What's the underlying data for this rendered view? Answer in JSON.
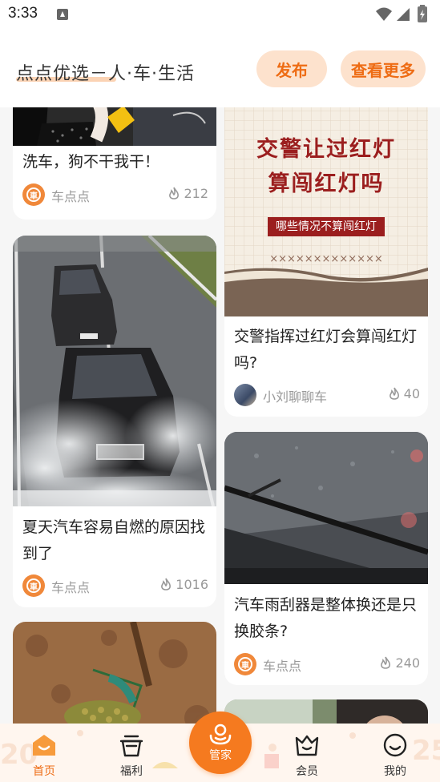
{
  "status_bar": {
    "time": "3:33"
  },
  "header": {
    "brand": "点点优选－人·车·生活",
    "publish_label": "发布",
    "more_label": "查看更多"
  },
  "feed": {
    "left": [
      {
        "title": "洗车，狗不干我干！",
        "author": "车点点",
        "likes": "212"
      },
      {
        "title": "夏天汽车容易自燃的原因找到了",
        "author": "车点点",
        "likes": "1016"
      },
      {
        "title": "",
        "author": "",
        "likes": ""
      }
    ],
    "right": [
      {
        "title": "交警指挥过红灯会算闯红灯吗?",
        "author": "小刘聊聊车",
        "likes": "40",
        "poster": {
          "line1": "交警让过红灯",
          "line2": "算闯红灯吗",
          "tag": "哪些情况不算闯红灯",
          "crosses": "×××××××××××××"
        }
      },
      {
        "title": "汽车雨刮器是整体换还是只换胶条?",
        "author": "车点点",
        "likes": "240"
      }
    ]
  },
  "bottom_nav": {
    "items": [
      {
        "label": "首页",
        "icon": "home-icon",
        "active": true
      },
      {
        "label": "福利",
        "icon": "gift-basket-icon",
        "active": false
      },
      {
        "label": "管家",
        "icon": "butler-icon",
        "active": false
      },
      {
        "label": "会员",
        "icon": "crown-icon",
        "active": false
      },
      {
        "label": "我的",
        "icon": "smile-icon",
        "active": false
      }
    ]
  },
  "colors": {
    "accent": "#f57a1f",
    "pill_bg": "#fde2cd",
    "poster_red": "#9b1e1e"
  }
}
